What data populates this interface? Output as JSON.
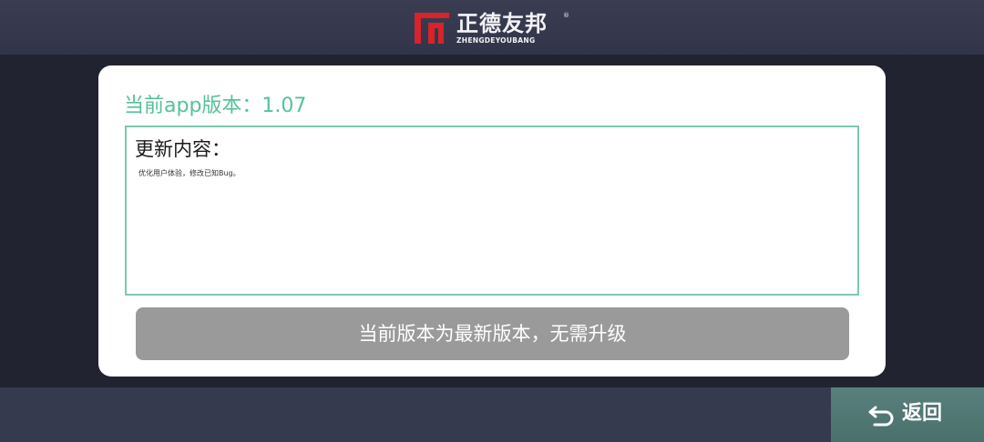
{
  "header": {
    "logo_cn": "正德友邦",
    "logo_reg": "®",
    "logo_en": "ZHENGDEYOUBANG",
    "logo_mark_icon": "zdyb-logo-icon",
    "brand_red": "#d8232a"
  },
  "update": {
    "version_line": "当前app版本：1.07",
    "content_title": "更新内容：",
    "content_text": "优化用户体验，修改已知Bug。",
    "status_button": "当前版本为最新版本，无需升级"
  },
  "footer": {
    "back_label": "返回",
    "back_icon": "return-arrow-icon"
  },
  "colors": {
    "accent_green": "#56c198",
    "status_button_gray": "#9a9a9a",
    "back_button_teal": "#52787a",
    "background": "#212331"
  }
}
